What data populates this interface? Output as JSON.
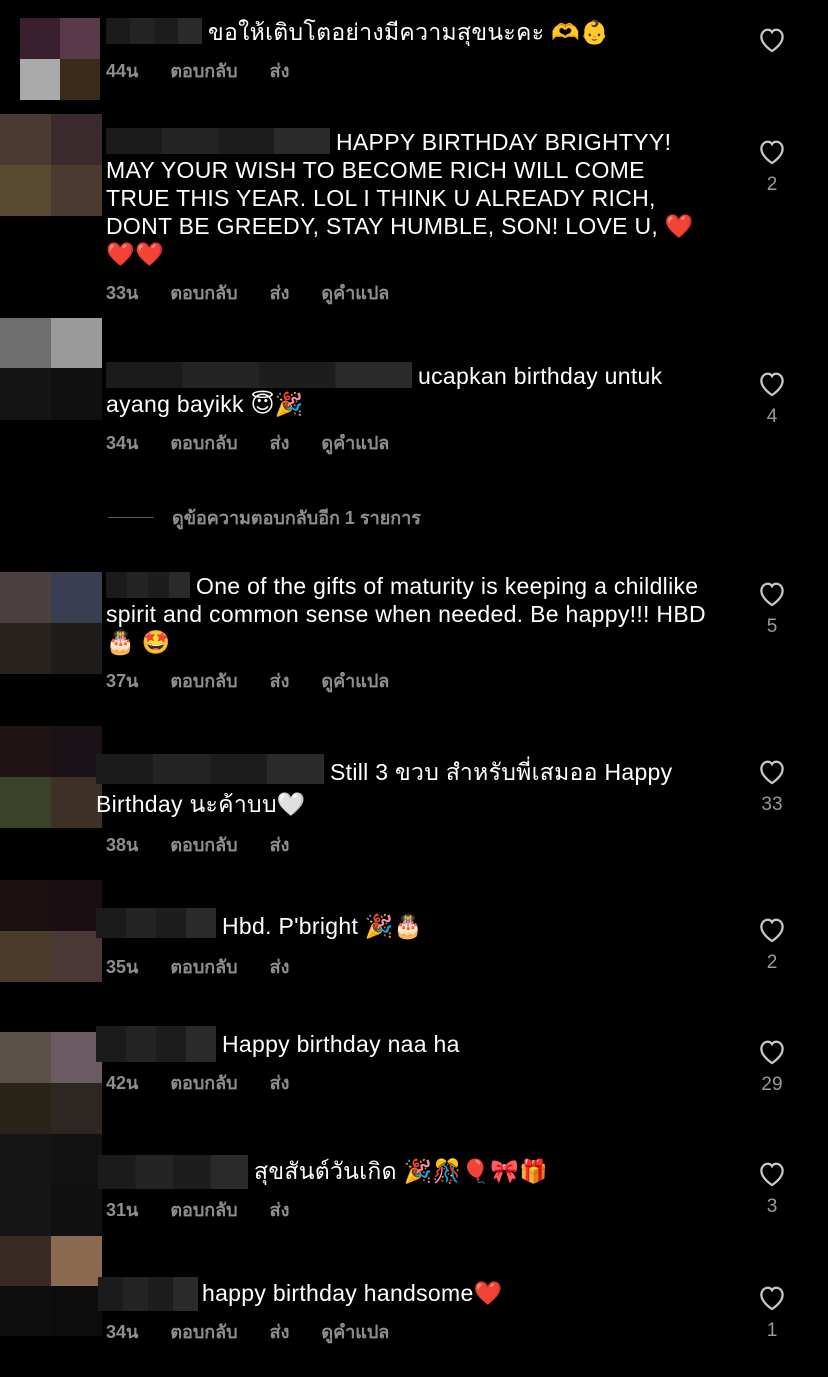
{
  "labels": {
    "reply": "ตอบกลับ",
    "send": "ส่ง",
    "translate": "ดูคำแปล"
  },
  "more_replies": "ดูข้อความตอบกลับอีก 1 รายการ",
  "comments": [
    {
      "text": "ขอให้เติบโตอย่างมีความสุขนะคะ 🫶👶",
      "time": "44น",
      "likes": "",
      "avatar_colors": [
        "#3a1f2e",
        "#5a3a4a",
        "#aaaaaa",
        "#3a2a1a"
      ]
    },
    {
      "text": "HAPPY BIRTHDAY BRIGHTYY! MAY YOUR WISH TO BECOME RICH WILL COME TRUE THIS YEAR. LOL I THINK U ALREADY RICH, DONT BE GREEDY, STAY HUMBLE, SON! LOVE U, ❤️ ❤️❤️",
      "time": "33น",
      "likes": "2",
      "avatar_colors": [
        "#4a3a32",
        "#3a2a2e",
        "#5a4a32",
        "#4a3a30"
      ]
    },
    {
      "text": "ucapkan birthday untuk ayang bayikk 😇🎉",
      "time": "34น",
      "likes": "4",
      "avatar_colors": [
        "#6e6e6e",
        "#9a9a9a",
        "#141414",
        "#101010"
      ]
    },
    {
      "text": "One of the gifts of maturity is keeping a childlike spirit and common sense when needed. Be happy!!! HBD 🎂 🤩",
      "time": "37น",
      "likes": "5",
      "avatar_colors": [
        "#4a4040",
        "#3a3e52",
        "#2a221e",
        "#201c1a"
      ]
    },
    {
      "text": "Still 3 ขวบ สำหรับพี่เสมออ Happy Birthday นะค้าบบ🤍",
      "time": "38น",
      "likes": "33",
      "avatar_colors": [
        "#1e1414",
        "#1a1216",
        "#3a4228",
        "#3e3026"
      ]
    },
    {
      "text": "Hbd. P'bright 🎉🎂",
      "time": "35น",
      "likes": "2",
      "avatar_colors": [
        "#1a1010",
        "#1a0e12",
        "#4a3a2a",
        "#4a3836"
      ]
    },
    {
      "text": "Happy birthday naa ha",
      "time": "42น",
      "likes": "29",
      "avatar_colors": [
        "#5a5048",
        "#6a5a62",
        "#2a2418",
        "#2e2622"
      ]
    },
    {
      "text": "สุขสันต์วันเกิด 🎉🎊🎈🎀🎁",
      "time": "31น",
      "likes": "3",
      "avatar_colors": [
        "#151515",
        "#121212",
        "#161616",
        "#101010"
      ]
    },
    {
      "text": "happy birthday handsome❤️",
      "time": "34น",
      "likes": "1",
      "avatar_colors": [
        "#3a2a24",
        "#8a6a50",
        "#0e0e0e",
        "#0c0c0c"
      ]
    }
  ]
}
